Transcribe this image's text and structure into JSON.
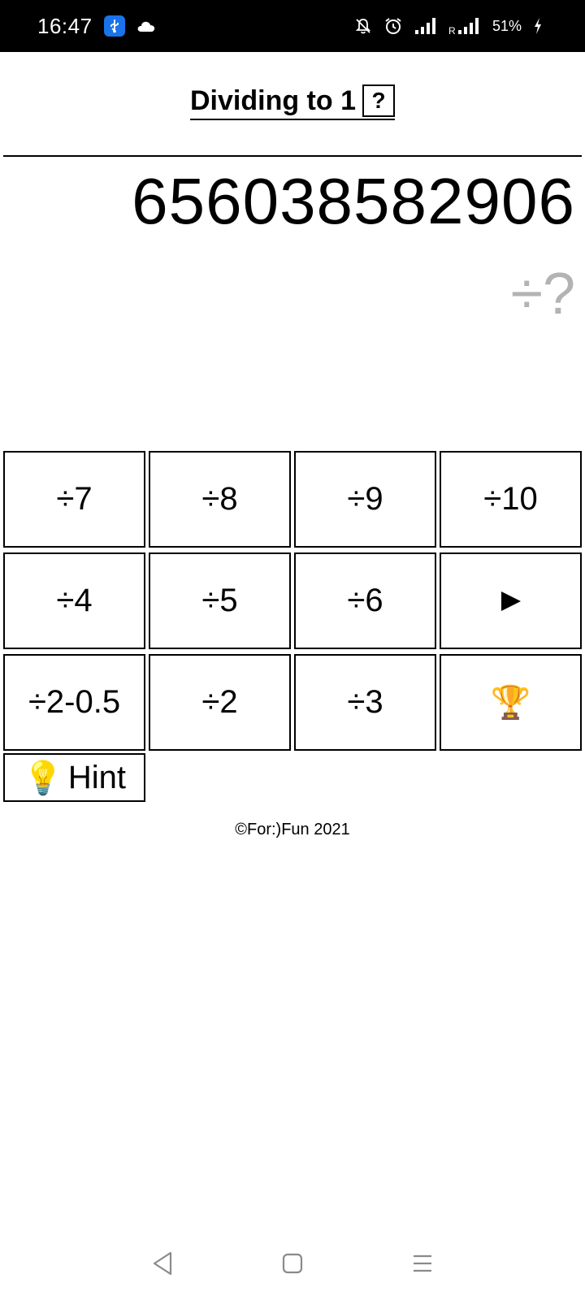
{
  "status_bar": {
    "time": "16:47",
    "battery": "51%",
    "icons": [
      "usb-icon",
      "cloud-icon",
      "mute-icon",
      "alarm-icon",
      "signal-icon",
      "roaming-signal-icon",
      "charging-icon"
    ],
    "roaming_label": "R"
  },
  "header": {
    "title": "Dividing to 1",
    "help_label": "?"
  },
  "game": {
    "number": "656038582906",
    "divisor_hint": "÷?"
  },
  "buttons": {
    "row1": [
      "÷7",
      "÷8",
      "÷9",
      "÷10"
    ],
    "row2": [
      "÷4",
      "÷5",
      "÷6"
    ],
    "row3": [
      "÷2-0.5",
      "÷2",
      "÷3"
    ],
    "trophy": "🏆",
    "hint_icon": "💡",
    "hint_label": "Hint"
  },
  "footer": {
    "copyright": "©For:)Fun 2021"
  },
  "colors": {
    "usb_badge": "#1a73e8",
    "hint_text": "#b3b3b3"
  }
}
